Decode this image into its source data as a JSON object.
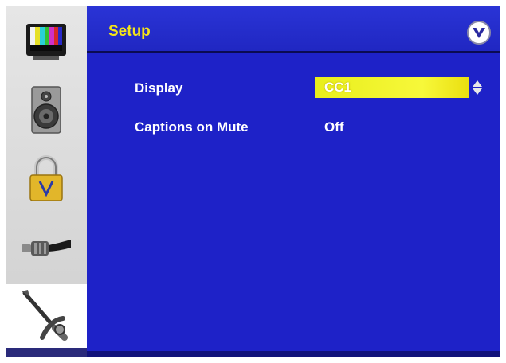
{
  "header": {
    "title": "Setup"
  },
  "sidebar": {
    "items": [
      {
        "icon": "tv-color-bars-icon"
      },
      {
        "icon": "speaker-icon"
      },
      {
        "icon": "lock-icon"
      },
      {
        "icon": "cable-connector-icon"
      },
      {
        "icon": "wrench-tools-icon",
        "selected": true
      }
    ]
  },
  "settings": [
    {
      "label": "Display",
      "value": "CC1"
    },
    {
      "label": "Captions on Mute",
      "value": "Off"
    }
  ],
  "colors": {
    "panel": "#1e22c8",
    "title_text": "#f4e419",
    "highlight": "#f0f22a",
    "sidebar": "#d9d9d9"
  }
}
